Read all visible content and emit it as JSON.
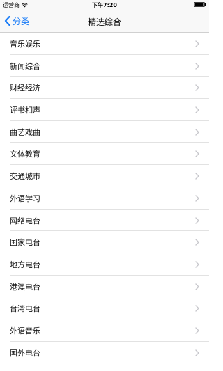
{
  "status_bar": {
    "carrier": "运营商",
    "time": "下午7:20"
  },
  "nav": {
    "back_label": "分类",
    "title": "精选综合"
  },
  "colors": {
    "accent": "#1a7cf7",
    "chevron": "#c7c7cc",
    "separator": "#e2e2e2"
  },
  "list": {
    "items": [
      {
        "label": "音乐娱乐"
      },
      {
        "label": "新闻综合"
      },
      {
        "label": "财经经济"
      },
      {
        "label": "评书相声"
      },
      {
        "label": "曲艺戏曲"
      },
      {
        "label": "文体教育"
      },
      {
        "label": "交通城市"
      },
      {
        "label": "外语学习"
      },
      {
        "label": "网络电台"
      },
      {
        "label": "国家电台"
      },
      {
        "label": "地方电台"
      },
      {
        "label": "港澳电台"
      },
      {
        "label": "台湾电台"
      },
      {
        "label": "外语音乐"
      },
      {
        "label": "国外电台"
      }
    ]
  }
}
